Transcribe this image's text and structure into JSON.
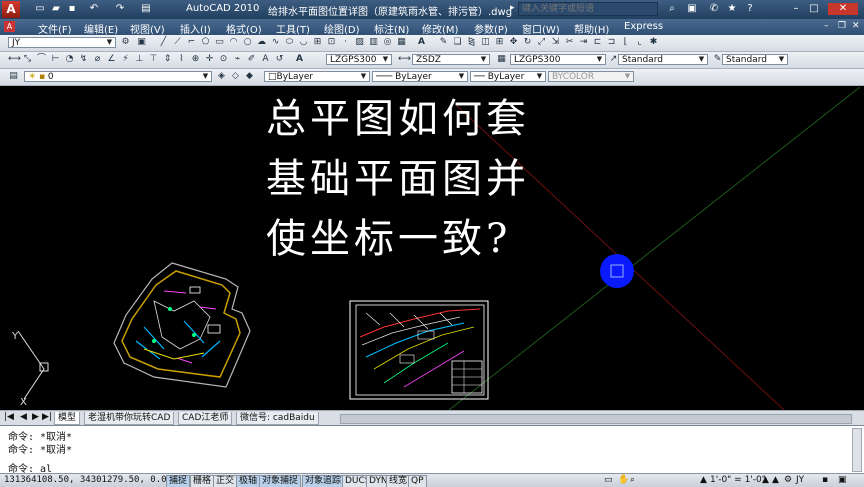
{
  "titlebar": {
    "app_name": "AutoCAD 2010",
    "document_title": "给排水平面图位置详图（原建筑雨水管、排污管）.dwg",
    "search_placeholder": "键入关键字或短语"
  },
  "menu": {
    "items": [
      "文件(F)",
      "编辑(E)",
      "视图(V)",
      "插入(I)",
      "格式(O)",
      "工具(T)",
      "绘图(D)",
      "标注(N)",
      "修改(M)",
      "参数(P)",
      "窗口(W)",
      "帮助(H)",
      "Express"
    ]
  },
  "toolbar": {
    "workspace": "JY",
    "styles": {
      "text_style": "LZGPS300",
      "dim_style": "ZSDZ",
      "table_style": "LZGPS300",
      "multileader_style": "Standard",
      "standard2": "Standard"
    },
    "layer": {
      "current": "0"
    },
    "properties": {
      "color": "ByLayer",
      "linetype": "ByLayer",
      "lineweight": "ByLayer",
      "plotstyle": "BYCOLOR"
    }
  },
  "overlay": {
    "line1": "总平图如何套",
    "line2": "基础平面图并",
    "line3": "使坐标一致?"
  },
  "ucs": {
    "x_label": "X",
    "y_label": "Y"
  },
  "tabs": {
    "items": [
      "模型",
      "老湿机带你玩转CAD",
      "CAD江老师",
      "微信号: cadBaidu"
    ]
  },
  "command": {
    "lines": [
      "命令: *取消*",
      "命令: *取消*"
    ],
    "current": "命令: al"
  },
  "status": {
    "coordinates": "131364108.50, 34301279.50, 0.00",
    "buttons": [
      "捕捉",
      "栅格",
      "正交",
      "极轴",
      "对象捕捉",
      "对象追踪",
      "DUCS",
      "DYN",
      "线宽",
      "QP"
    ],
    "scale1": "1'-0\" = 1'-0\"",
    "annotation": "JY"
  },
  "colors": {
    "canvas": "#000000",
    "circle": "#0a1aff",
    "red_line": "#6a1010",
    "green_line": "#1c5a1c"
  }
}
